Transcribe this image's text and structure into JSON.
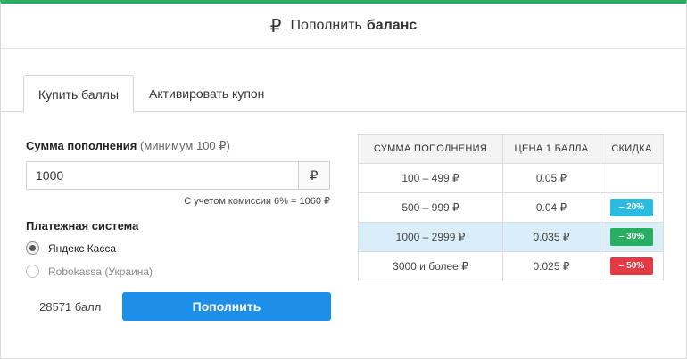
{
  "header": {
    "currency_symbol": "₽",
    "title_light": "Пополнить",
    "title_bold": "баланс"
  },
  "tabs": [
    {
      "label": "Купить баллы"
    },
    {
      "label": "Активировать купон"
    }
  ],
  "amount": {
    "label": "Сумма пополнения",
    "hint": "(минимум 100 ₽)",
    "value": "1000",
    "currency": "₽",
    "commission_note": "С учетом комиссии 6% = 1060 ₽"
  },
  "payment": {
    "label": "Платежная система",
    "options": [
      {
        "label": "Яндекс Касса",
        "selected": true
      },
      {
        "label": "Robokassa (Украина)",
        "selected": false
      }
    ]
  },
  "summary": {
    "points": "28571 балл",
    "submit_label": "Пополнить"
  },
  "table": {
    "headers": [
      "СУММА ПОПОЛНЕНИЯ",
      "ЦЕНА 1 БАЛЛА",
      "СКИДКА"
    ],
    "rows": [
      {
        "range": "100 – 499 ₽",
        "price": "0.05 ₽",
        "discount": ""
      },
      {
        "range": "500 – 999 ₽",
        "price": "0.04 ₽",
        "discount": "– 20%",
        "badge_color": "#2bbbe0"
      },
      {
        "range": "1000 – 2999 ₽",
        "price": "0.035 ₽",
        "discount": "– 30%",
        "badge_color": "#27ae60"
      },
      {
        "range": "3000 и более ₽",
        "price": "0.025 ₽",
        "discount": "– 50%",
        "badge_color": "#e43a45"
      }
    ]
  },
  "colors": {
    "accent": "#27ae60",
    "button": "#1e8fe8",
    "highlight_row": "#d9eef9"
  }
}
